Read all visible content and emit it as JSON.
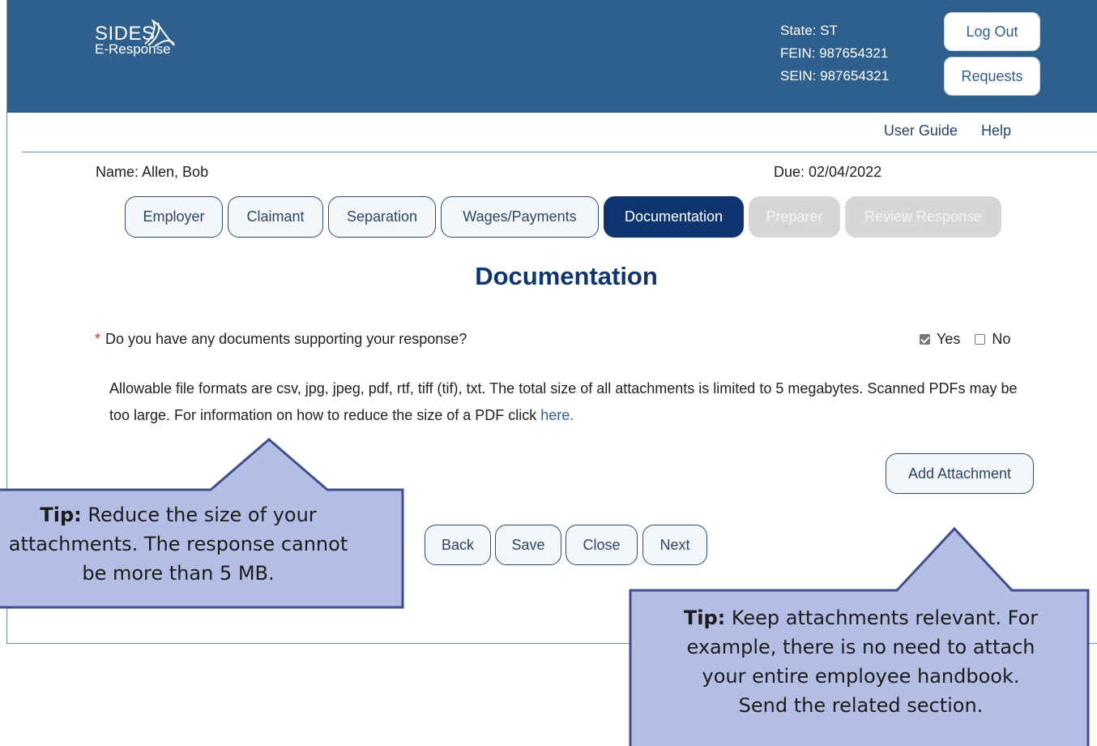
{
  "header": {
    "logo_main": "SIDES",
    "logo_sub": "E-Response",
    "state": "State: ST",
    "fein": "FEIN: 987654321",
    "sein": "SEIN: 987654321",
    "logout_label": "Log Out",
    "requests_label": "Requests"
  },
  "util_links": {
    "user_guide": "User Guide",
    "help": "Help"
  },
  "claim": {
    "name": "Name:  Allen, Bob",
    "due": "Due:  02/04/2022"
  },
  "tabs": [
    {
      "label": "Employer",
      "state": "enabled"
    },
    {
      "label": "Claimant",
      "state": "enabled"
    },
    {
      "label": "Separation",
      "state": "enabled"
    },
    {
      "label": "Wages/Payments",
      "state": "enabled"
    },
    {
      "label": "Documentation",
      "state": "active"
    },
    {
      "label": "Preparer",
      "state": "disabled"
    },
    {
      "label": "Review Response",
      "state": "disabled"
    }
  ],
  "main": {
    "title": "Documentation",
    "question_marker": "*",
    "question": "Do you have any documents supporting your response?",
    "yes_label": "Yes",
    "no_label": "No",
    "yes_checked": true,
    "no_checked": false,
    "info_text": "Allowable file formats are csv, jpg, jpeg, pdf, rtf, tiff (tif), txt. The total size of all attachments is limited to 5 megabytes. Scanned PDFs may be too large. For information on how to reduce the size of a PDF click ",
    "info_link": "here",
    "info_end": ".",
    "add_attachment_label": "Add Attachment"
  },
  "nav_buttons": {
    "back": "Back",
    "save": "Save",
    "close": "Close",
    "next": "Next"
  },
  "tips": {
    "tip1_label": "Tip:",
    "tip1_line1": " Reduce the size of your",
    "tip1_line2": "attachments. The response cannot",
    "tip1_line3": "be more than 5 MB.",
    "tip2_label": "Tip:",
    "tip2_line1": " Keep attachments relevant. For",
    "tip2_line2": "example, there is no need to attach",
    "tip2_line3": "your entire employee handbook.",
    "tip2_line4": "Send the related section."
  },
  "colors": {
    "header_bg": "#2f5f8c",
    "active_tab": "#0f3570",
    "disabled_tab": "#d6d6d6",
    "callout_fill": "#b4bde4",
    "callout_border": "#3f4f8c"
  }
}
